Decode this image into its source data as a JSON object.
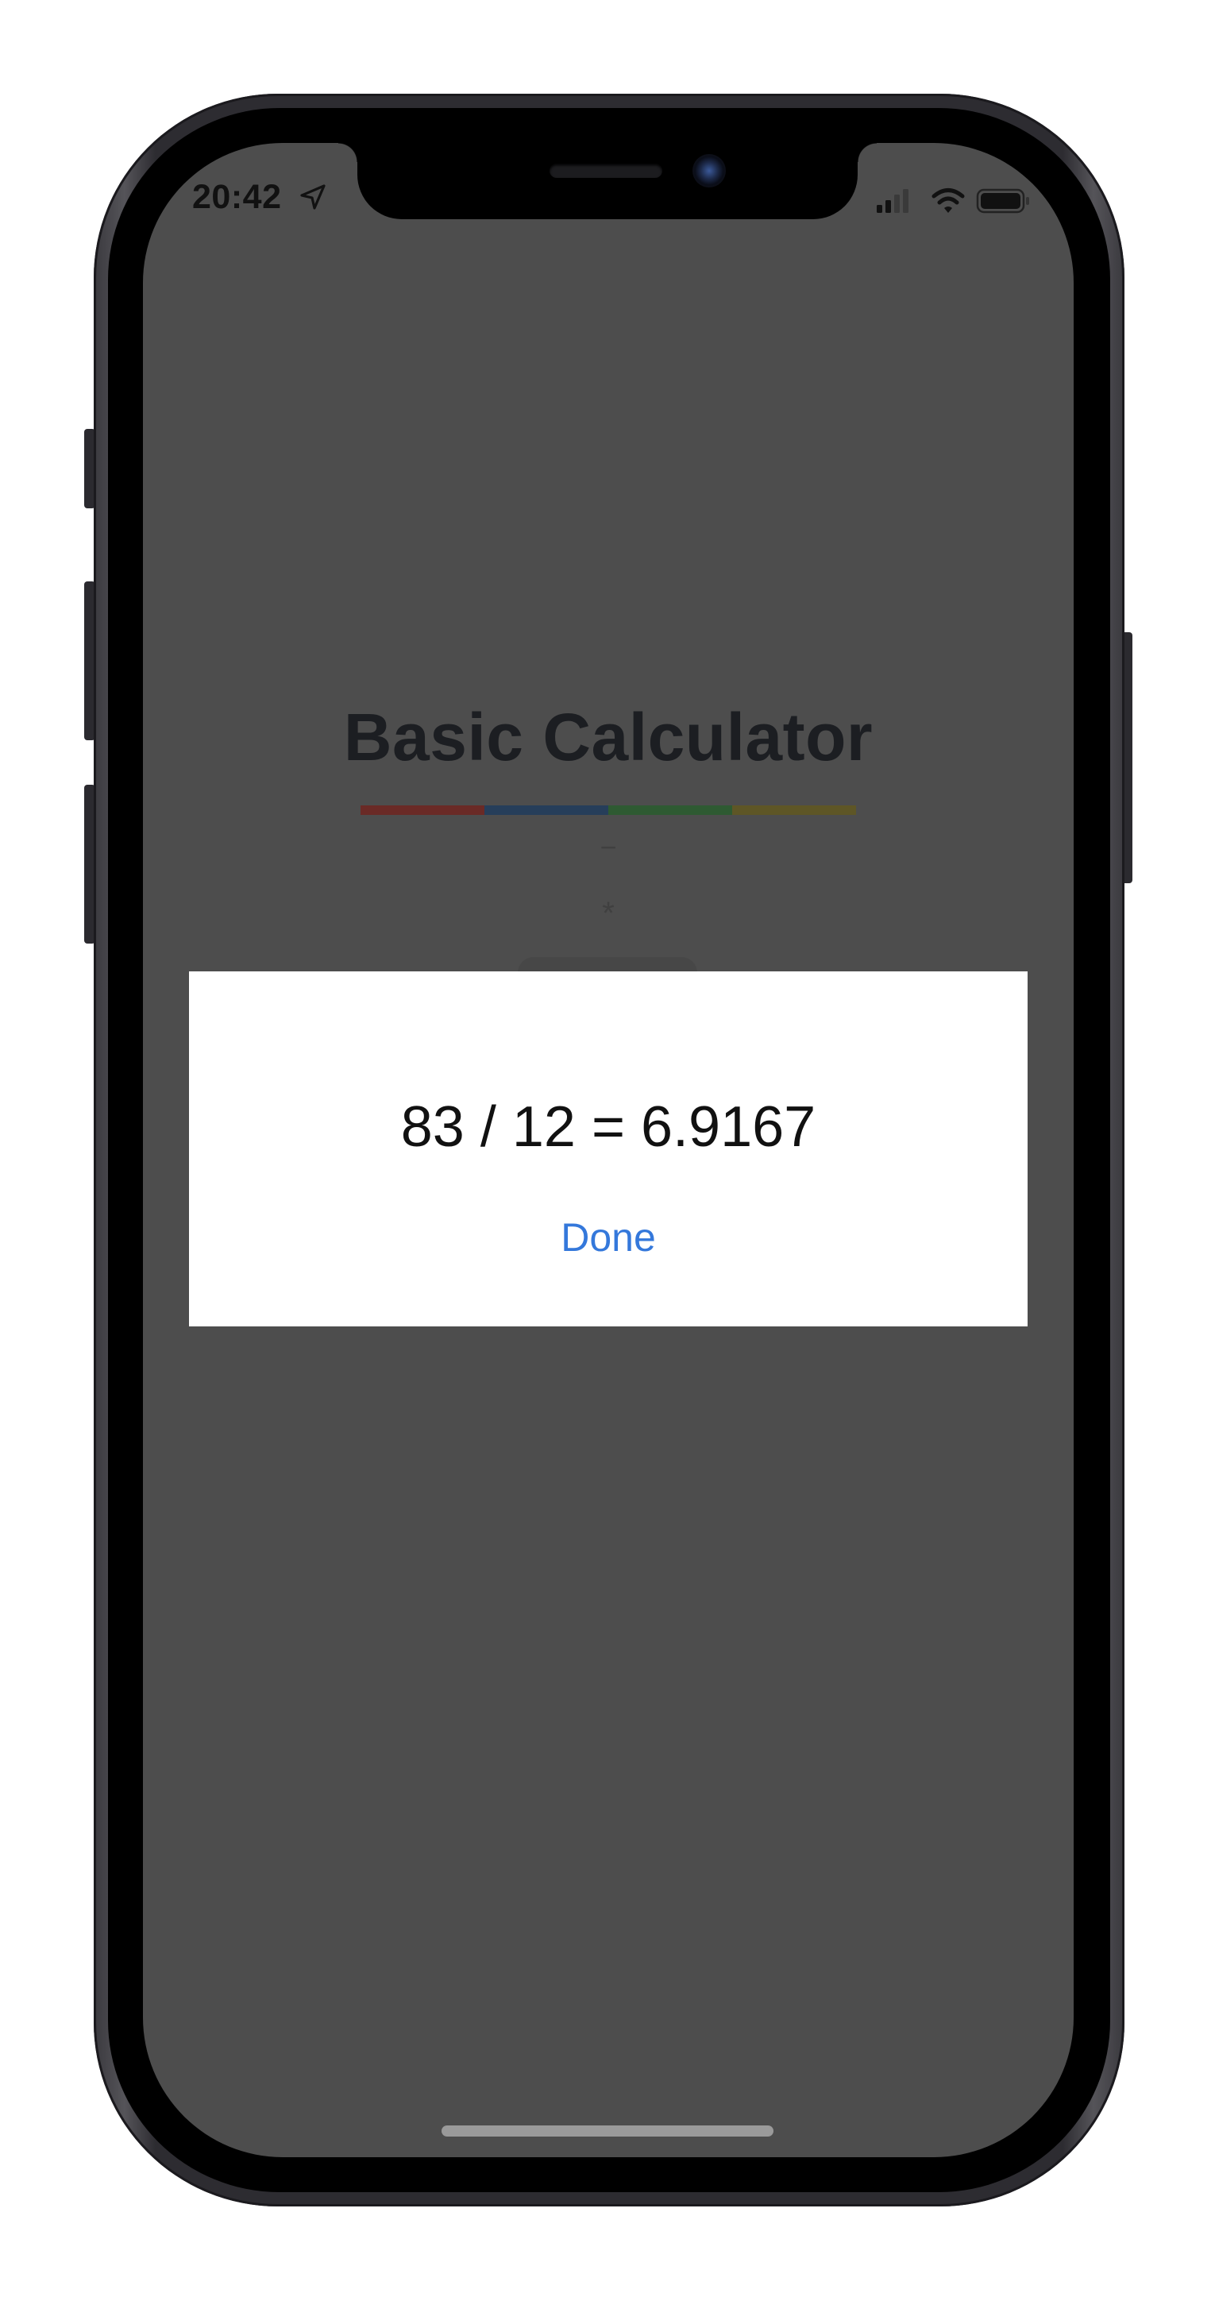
{
  "status_bar": {
    "time": "20:42",
    "icons": [
      "location-arrow-icon",
      "cellular-signal-icon",
      "wifi-icon",
      "battery-icon"
    ]
  },
  "app": {
    "title": "Basic Calculator",
    "underline_colors": [
      "#6a2a26",
      "#263e5a",
      "#2e5a32",
      "#5e5626"
    ],
    "operators_visible": [
      "−",
      "*"
    ]
  },
  "modal": {
    "result_text": "83 / 12 = 6.9167",
    "done_label": "Done"
  },
  "colors": {
    "overlay_background": "#4d4d4d",
    "modal_background": "#ffffff",
    "accent_link": "#3478db"
  }
}
